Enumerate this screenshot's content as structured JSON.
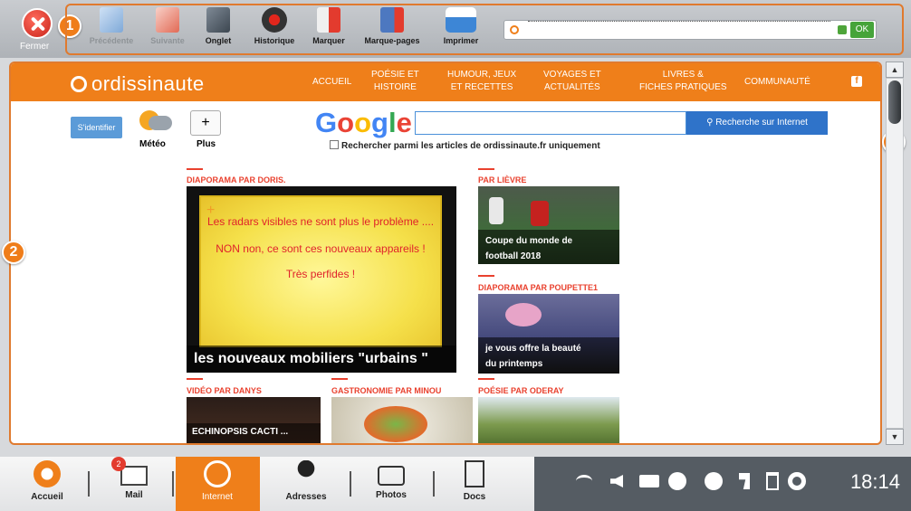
{
  "toolbar": {
    "close_label": "Fermer",
    "back_label": "Précédente",
    "forward_label": "Suivante",
    "tab_label": "Onglet",
    "history_label": "Historique",
    "bookmark_label": "Marquer",
    "bookmarks_label": "Marque-pages",
    "print_label": "Imprimer",
    "ok_label": "OK"
  },
  "badges": {
    "one": "1",
    "two": "2",
    "three": "3"
  },
  "site": {
    "logo": "ordissinaute",
    "nav": [
      {
        "line1": "ACCUEIL",
        "line2": ""
      },
      {
        "line1": "POÉSIE ET",
        "line2": "HISTOIRE"
      },
      {
        "line1": "HUMOUR, JEUX",
        "line2": "ET RECETTES"
      },
      {
        "line1": "VOYAGES ET",
        "line2": "ACTUALITÉS"
      },
      {
        "line1": "LIVRES &",
        "line2": "FICHES PRATIQUES"
      },
      {
        "line1": "COMMUNAUTÉ",
        "line2": ""
      }
    ],
    "login_label": "S'identifier",
    "meteo_label": "Météo",
    "plus_symbol": "+",
    "plus_label": "Plus",
    "google": {
      "g": "G",
      "o1": "o",
      "o2": "o",
      "g2": "g",
      "l": "l",
      "e": "e"
    },
    "search_button": "Recherche sur Internet",
    "checkbox_label": "Rechercher parmi les articles de ordissinaute.fr uniquement",
    "cards": {
      "main": {
        "category": "DIAPORAMA PAR DORIS.",
        "slide_lines": [
          "Les radars visibles ne sont plus le problème ....",
          "NON non, ce sont ces nouveaux appareils !",
          "Très perfides !"
        ],
        "caption": "les nouveaux mobiliers \"urbains \""
      },
      "football": {
        "category": "PAR LIÈVRE",
        "caption_line1": "Coupe du monde de",
        "caption_line2": "football 2018"
      },
      "spring": {
        "category": "DIAPORAMA PAR POUPETTE1",
        "caption_line1": "je vous offre la beauté",
        "caption_line2": "du printemps"
      },
      "video": {
        "category": "VIDÉO PAR DANYS",
        "caption": "ECHINOPSIS CACTI ..."
      },
      "gastro": {
        "category": "GASTRONOMIE PAR MINOU"
      },
      "poesie": {
        "category": "POÉSIE PAR ODERAY"
      }
    }
  },
  "dock": {
    "items": [
      "Accueil",
      "Mail",
      "Internet",
      "Adresses",
      "Photos",
      "Docs"
    ],
    "mail_badge": "2",
    "time": "18:14"
  },
  "colors": {
    "accent": "#ef7f1a",
    "highlight": "#e07a2e",
    "link_red": "#e9412e"
  }
}
